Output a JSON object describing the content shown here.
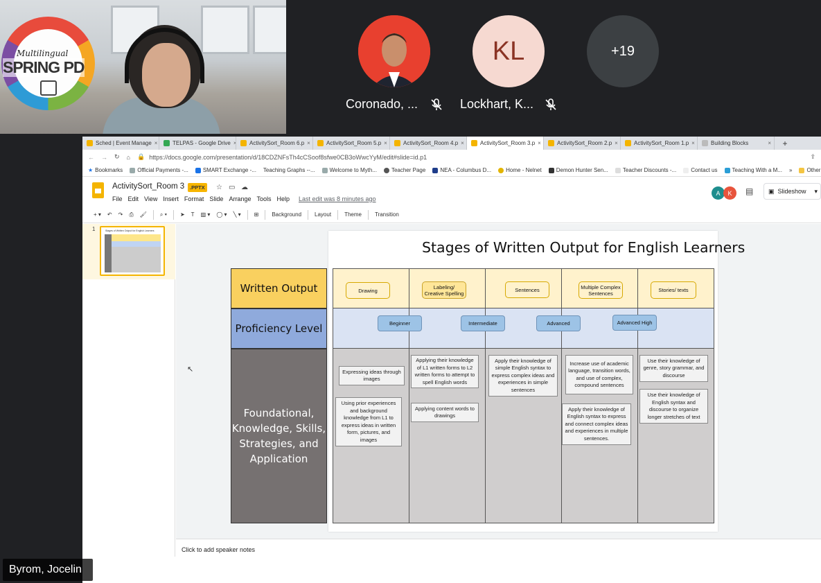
{
  "meeting": {
    "presenter_name": "Byrom, Jocelin",
    "logo_line1": "Multilingual",
    "logo_line2": "SPRING PD",
    "participants": [
      {
        "name": "Coronado, ...",
        "initials": "",
        "muted": true
      },
      {
        "name": "Lockhart, K...",
        "initials": "KL",
        "muted": true
      }
    ],
    "more_count": "+19"
  },
  "browser": {
    "tabs": [
      {
        "label": "Sched | Event Manage",
        "active": false
      },
      {
        "label": "TELPAS - Google Drive",
        "active": false
      },
      {
        "label": "ActivitySort_Room 6.p",
        "active": false
      },
      {
        "label": "ActivitySort_Room 5.p",
        "active": false
      },
      {
        "label": "ActivitySort_Room 4.p",
        "active": false
      },
      {
        "label": "ActivitySort_Room 3.p",
        "active": true
      },
      {
        "label": "ActivitySort_Room 2.p",
        "active": false
      },
      {
        "label": "ActivitySort_Room 1.p",
        "active": false
      },
      {
        "label": "Building Blocks",
        "active": false
      }
    ],
    "new_tab": "+",
    "url": "https://docs.google.com/presentation/d/18CDZNFsTh4cCSoof8sfwe0CB3oWwcYyM/edit#slide=id.p1",
    "bookmarks": [
      "Bookmarks",
      "Official Payments -...",
      "SMART Exchange -...",
      "Teaching Graphs --...",
      "Welcome to Myth...",
      "Teacher Page",
      "NEA - Columbus D...",
      "Home - Nelnet",
      "Demon Hunter Sen...",
      "Teacher Discounts -...",
      "Contact us",
      "Teaching With a M...",
      "»",
      "Other b"
    ]
  },
  "slides_app": {
    "doc_title": "ActivitySort_Room 3",
    "badge": ".PPTX",
    "menus": [
      "File",
      "Edit",
      "View",
      "Insert",
      "Format",
      "Slide",
      "Arrange",
      "Tools",
      "Help"
    ],
    "last_edit": "Last edit was 8 minutes ago",
    "slideshow_label": "Slideshow",
    "collaborators": [
      {
        "initial": "A",
        "color": "#1e8e8e"
      },
      {
        "initial": "K",
        "color": "#e8543c"
      }
    ],
    "toolbar": {
      "background": "Background",
      "layout": "Layout",
      "theme": "Theme",
      "transition": "Transition"
    },
    "slide_number": "1",
    "thumb_title": "Stages of Written Output for English Learners",
    "speaker_notes": "Click to add speaker notes"
  },
  "slide": {
    "title": "Stages of Written Output for English Learners",
    "row_labels": [
      "Written Output",
      "Proficiency Level",
      "Foundational, Knowledge, Skills, Strategies, and Application"
    ],
    "output_cards": [
      "Drawing",
      "Labeling/ Creative Spelling",
      "Sentences",
      "Multiple Complex Sentences",
      "Stories/ texts"
    ],
    "proficiency_cards": [
      "Beginner",
      "Intermediate",
      "Advanced",
      "Advanced High"
    ],
    "skill_cards": [
      "Expressing ideas through images",
      "Using prior experiences and background knowledge from L1 to express ideas in written form, pictures, and images",
      "Applying their knowledge of L1 written forms to L2 written forms to attempt to spell English words",
      "Applying content words to drawings",
      "Apply their knowledge of simple English syntax to express complex ideas and experiences in simple sentences",
      "Increase use of academic language, transition words, and use of complex, compound sentences",
      "Apply their knowledge of English syntax to express and connect complex ideas and experiences in multiple sentences.",
      "Use their knowledge of genre, story grammar, and discourse",
      "Use their knowledge of English syntax and discourse to organize longer stretches of text"
    ]
  },
  "colors": {
    "accent_yellow": "#f4b400",
    "written_row": "#f9d05f",
    "proficiency_row": "#8faadc",
    "foundation_row": "#767171"
  }
}
